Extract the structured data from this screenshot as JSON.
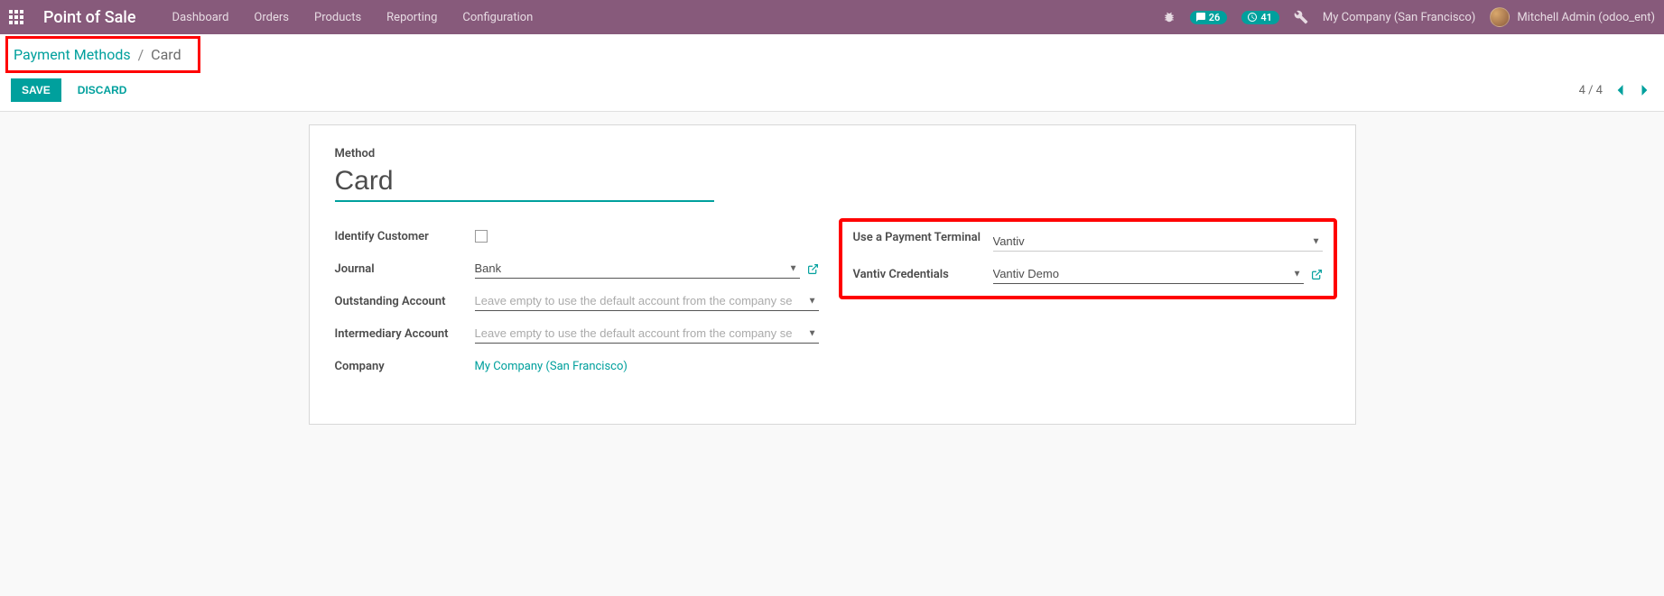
{
  "navbar": {
    "app_title": "Point of Sale",
    "items": [
      "Dashboard",
      "Orders",
      "Products",
      "Reporting",
      "Configuration"
    ],
    "msg_count": "26",
    "activity_count": "41",
    "company": "My Company (San Francisco)",
    "user": "Mitchell Admin (odoo_ent)"
  },
  "breadcrumb": {
    "parent": "Payment Methods",
    "current": "Card"
  },
  "buttons": {
    "save": "SAVE",
    "discard": "DISCARD"
  },
  "pager": {
    "text": "4 / 4"
  },
  "form": {
    "method_label": "Method",
    "method_value": "Card",
    "left": {
      "identify_customer_label": "Identify Customer",
      "journal_label": "Journal",
      "journal_value": "Bank",
      "outstanding_label": "Outstanding Account",
      "outstanding_placeholder": "Leave empty to use the default account from the company se",
      "intermediary_label": "Intermediary Account",
      "intermediary_placeholder": "Leave empty to use the default account from the company se",
      "company_label": "Company",
      "company_value": "My Company (San Francisco)"
    },
    "right": {
      "terminal_label": "Use a Payment Terminal",
      "terminal_value": "Vantiv",
      "vantiv_label": "Vantiv Credentials",
      "vantiv_value": "Vantiv Demo"
    }
  }
}
